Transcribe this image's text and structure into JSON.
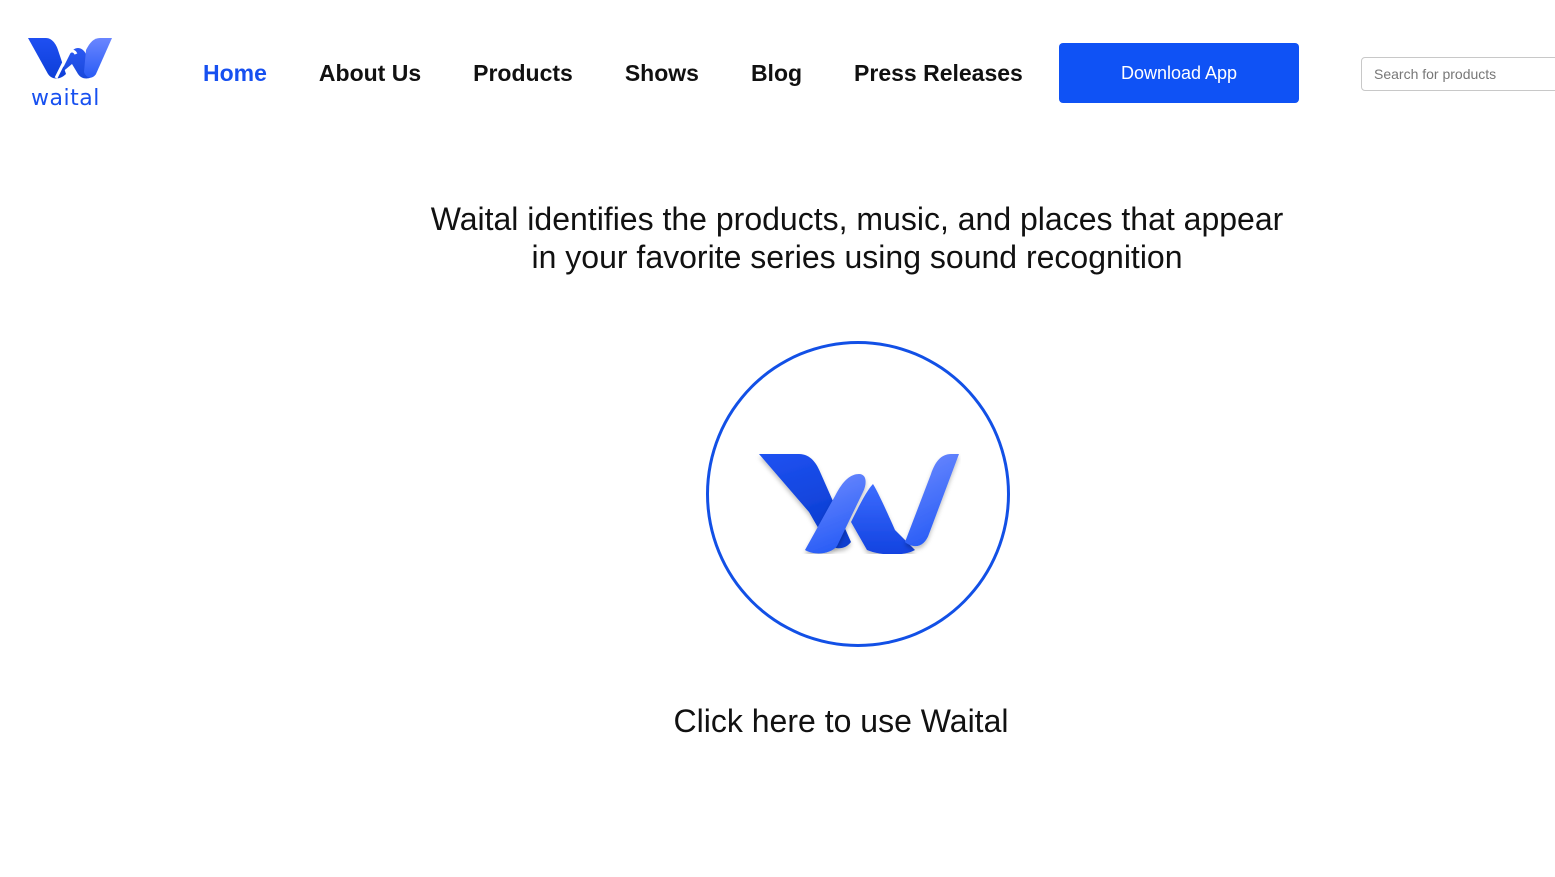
{
  "brand": {
    "name": "waital",
    "color": "#1750f0",
    "icon": "waital-w-logo-icon"
  },
  "nav": {
    "items": [
      {
        "label": "Home",
        "active": true
      },
      {
        "label": "About Us",
        "active": false
      },
      {
        "label": "Products",
        "active": false
      },
      {
        "label": "Shows",
        "active": false
      },
      {
        "label": "Blog",
        "active": false
      },
      {
        "label": "Press Releases",
        "active": false
      }
    ],
    "active_color": "#1750f0"
  },
  "download_button": {
    "label": "Download App",
    "color": "#0f52f5"
  },
  "search": {
    "placeholder": "Search for products",
    "value": ""
  },
  "hero": {
    "tagline_line1": "Waital identifies the products, music, and places that appear",
    "tagline_line2": "in your favorite series using sound recognition",
    "listen_button_icon": "waital-w-logo-icon",
    "cta_text": "Click here to use Waital",
    "circle_color": "#1250e6"
  }
}
